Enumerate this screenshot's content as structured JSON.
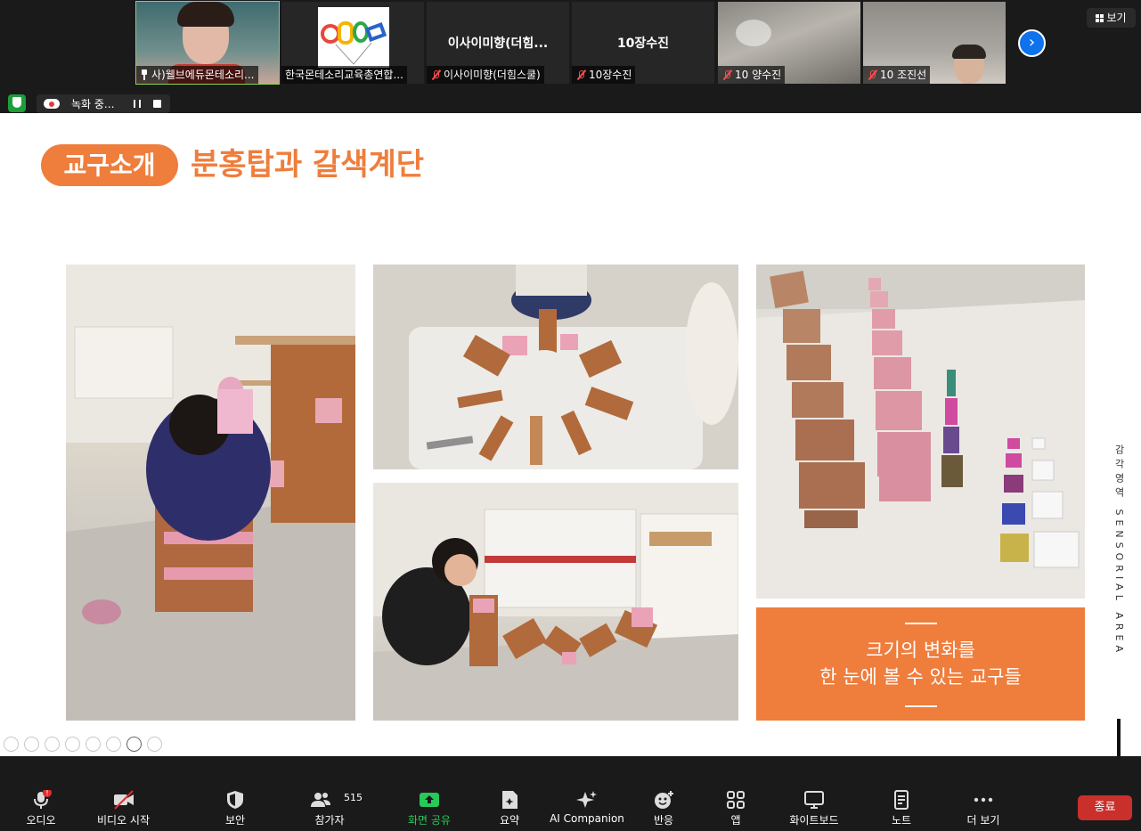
{
  "video_strip": {
    "tiles": [
      {
        "name": "사)웰브에듀몬테소리...",
        "center_name": ""
      },
      {
        "name": "한국몬테소리교육총연합...",
        "center_name": ""
      },
      {
        "name": "이사이미향(더힘스쿨)",
        "center_name": "이사이미향(더힘..."
      },
      {
        "name": "10장수진",
        "center_name": "10장수진"
      },
      {
        "name": "10 양수진",
        "center_name": ""
      },
      {
        "name": "10 조진선",
        "center_name": ""
      }
    ],
    "view_label": "보기",
    "next_icon": "chevron-right-icon"
  },
  "recording": {
    "label": "녹화 중..."
  },
  "slide": {
    "badge": "교구소개",
    "title": "분홍탑과 갈색계단",
    "caption_line1": "크기의 변화를",
    "caption_line2": "한 눈에 볼 수 있는 교구들",
    "side_label": "감각영역 SENSORIAL AREA",
    "accent_color": "#ef7d3c"
  },
  "toolbar": {
    "audio": "오디오",
    "video": "비디오 시작",
    "security": "보안",
    "participants": "참가자",
    "participants_count": "515",
    "share": "화면 공유",
    "summary": "요약",
    "ai_companion": "AI Companion",
    "reactions": "반응",
    "apps": "앱",
    "whiteboard": "화이트보드",
    "notes": "노트",
    "more": "더 보기",
    "end": "종료"
  }
}
